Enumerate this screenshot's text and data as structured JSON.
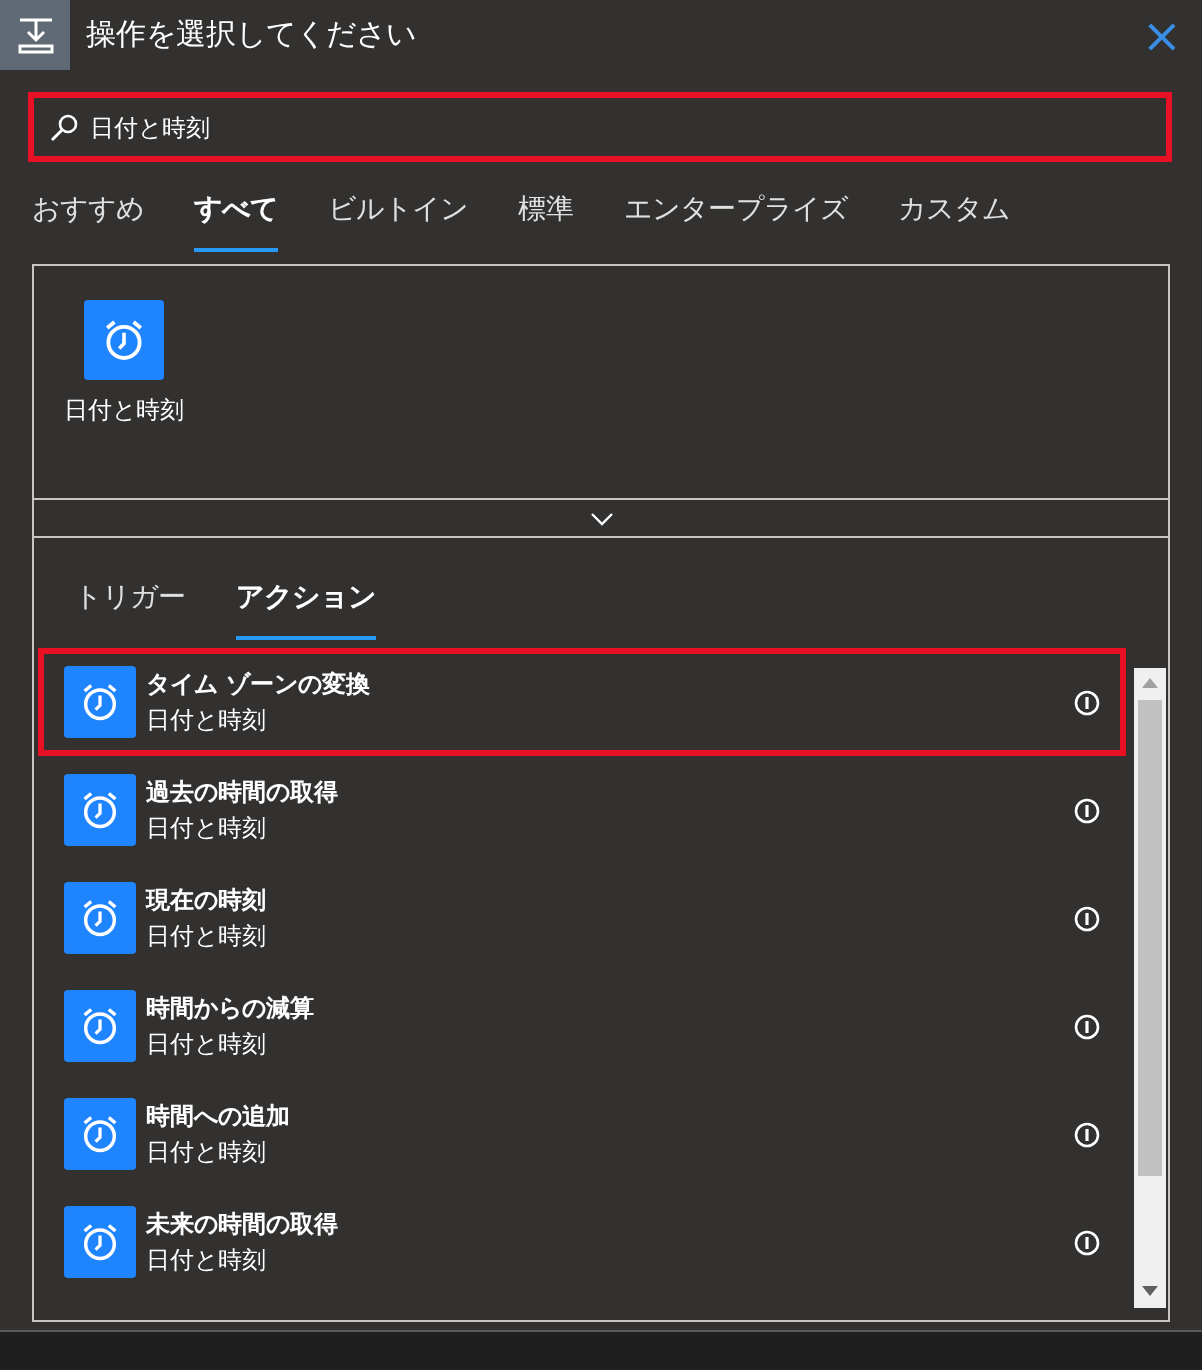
{
  "window": {
    "title": "操作を選択してください",
    "close": "×"
  },
  "search": {
    "value": "日付と時刻",
    "highlighted": true
  },
  "category_tabs": [
    {
      "label": "おすすめ",
      "selected": false
    },
    {
      "label": "すべて",
      "selected": true
    },
    {
      "label": "ビルトイン",
      "selected": false
    },
    {
      "label": "標準",
      "selected": false
    },
    {
      "label": "エンタープライズ",
      "selected": false
    },
    {
      "label": "カスタム",
      "selected": false
    }
  ],
  "connectors": [
    {
      "label": "日付と時刻"
    }
  ],
  "action_tabs": [
    {
      "label": "トリガー",
      "selected": false
    },
    {
      "label": "アクション",
      "selected": true
    }
  ],
  "actions": [
    {
      "title": "タイム ゾーンの変換",
      "subtitle": "日付と時刻",
      "highlighted": true
    },
    {
      "title": "過去の時間の取得",
      "subtitle": "日付と時刻",
      "highlighted": false
    },
    {
      "title": "現在の時刻",
      "subtitle": "日付と時刻",
      "highlighted": false
    },
    {
      "title": "時間からの減算",
      "subtitle": "日付と時刻",
      "highlighted": false
    },
    {
      "title": "時間への追加",
      "subtitle": "日付と時刻",
      "highlighted": false
    },
    {
      "title": "未来の時間の取得",
      "subtitle": "日付と時刻",
      "highlighted": false
    }
  ]
}
